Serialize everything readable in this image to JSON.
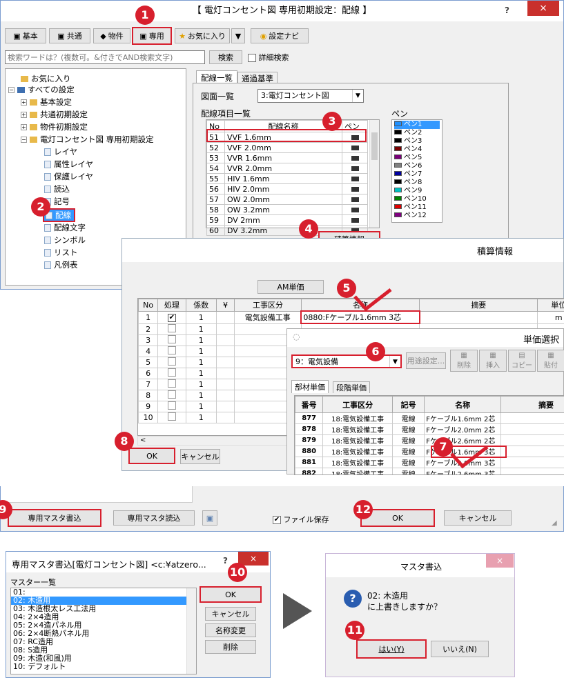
{
  "main": {
    "title": "【 電灯コンセント図 専用初期設定：配線 】",
    "help": "?",
    "close": "×",
    "toolbar": [
      "基本",
      "共通",
      "物件",
      "専用",
      "お気に入り",
      "▼",
      "設定ナビ"
    ],
    "search_placeholder": "検索ワードは？(複数可。&付きでAND検索文字)",
    "search_btn": "検索",
    "detail_label": "詳細検索",
    "tree": [
      "お気に入り",
      "すべての設定",
      "基本設定",
      "共通初期設定",
      "物件初期設定",
      "電灯コンセント図 専用初期設定",
      "レイヤ",
      "属性レイヤ",
      "保護レイヤ",
      "読込",
      "記号",
      "配線",
      "配線文字",
      "シンボル",
      "リスト",
      "凡例表"
    ],
    "tabs": [
      "配線一覧",
      "通過基準"
    ],
    "drawing_label": "図面一覧",
    "drawing_value": "3:電灯コンセント図",
    "items_label": "配線項目一覧",
    "col_no": "No",
    "col_name": "配線名称",
    "col_pen": "ペン",
    "rows": [
      [
        "51",
        "VVF 1.6mm"
      ],
      [
        "52",
        "VVF 2.0mm"
      ],
      [
        "53",
        "VVR 1.6mm"
      ],
      [
        "54",
        "VVR 2.0mm"
      ],
      [
        "55",
        "HIV 1.6mm"
      ],
      [
        "56",
        "HIV 2.0mm"
      ],
      [
        "57",
        "OW 2.0mm"
      ],
      [
        "58",
        "OW 3.2mm"
      ],
      [
        "59",
        "DV 2mm"
      ],
      [
        "60",
        "DV 3.2mm"
      ]
    ],
    "pen_label": "ペン",
    "pens": [
      [
        "ペン1",
        "#1e90ff"
      ],
      [
        "ペン2",
        "#000000"
      ],
      [
        "ペン3",
        "#000000"
      ],
      [
        "ペン4",
        "#7a0000"
      ],
      [
        "ペン5",
        "#7a007a"
      ],
      [
        "ペン6",
        "#808080"
      ],
      [
        "ペン7",
        "#0000a0"
      ],
      [
        "ペン8",
        "#000000"
      ],
      [
        "ペン9",
        "#00c0c0"
      ],
      [
        "ペン10",
        "#008000"
      ],
      [
        "ペン11",
        "#e00000"
      ],
      [
        "ペン12",
        "#800080"
      ]
    ],
    "estimate_btn": "積算情報",
    "master_write_btn": "専用マスタ書込",
    "master_read_btn": "専用マスタ読込",
    "file_save_label": "ファイル保存",
    "ok": "OK",
    "cancel": "キャンセル"
  },
  "estimate": {
    "title": "積算情報",
    "am_btn": "AM単価",
    "headers": [
      "No",
      "処理",
      "係数",
      "¥",
      "工事区分",
      "名称",
      "摘要",
      "単位"
    ],
    "row1": [
      "1",
      "✔",
      "1",
      "",
      "電気設備工事",
      "0880:Fケーブル1.6mm 3芯",
      "",
      "m"
    ],
    "rows": [
      "2",
      "3",
      "4",
      "5",
      "6",
      "7",
      "8",
      "9",
      "10"
    ],
    "coef": "1",
    "ok": "OK",
    "cancel": "キャンセル",
    "scroll_left": "<"
  },
  "unit_price": {
    "title": "単価選択",
    "select_value": "9：電気設備",
    "usage_btn": "用途設定...",
    "tools": [
      "削除",
      "挿入",
      "コピー",
      "貼付"
    ],
    "tabs": [
      "部材単価",
      "段階単価"
    ],
    "headers": [
      "番号",
      "工事区分",
      "記号",
      "名称",
      "摘要"
    ],
    "rows": [
      [
        "877",
        "18:電気設備工事",
        "電線",
        "Fケーブル1.6mm 2芯"
      ],
      [
        "878",
        "18:電気設備工事",
        "電線",
        "Fケーブル2.0mm 2芯"
      ],
      [
        "879",
        "18:電気設備工事",
        "電線",
        "Fケーブル2.6mm 2芯"
      ],
      [
        "880",
        "18:電気設備工事",
        "電線",
        "Fケーブル1.6mm 3芯"
      ],
      [
        "881",
        "18:電気設備工事",
        "電線",
        "Fケーブル2.0mm 3芯"
      ],
      [
        "882",
        "18:電気設備工事",
        "電線",
        "Fケーブル2.6mm 3芯"
      ]
    ]
  },
  "master_dialog": {
    "title": "専用マスタ書込[電灯コンセント図] <c:¥atzero...",
    "help": "?",
    "close": "×",
    "list_label": "マスター一覧",
    "items": [
      "01:",
      "02: 木造用",
      "03: 木造根太レス工法用",
      "04: 2×4造用",
      "05: 2×4造パネル用",
      "06: 2×4断熱パネル用",
      "07: RC造用",
      "08: S造用",
      "09: 木造(和風)用",
      "10: デフォルト"
    ],
    "ok": "OK",
    "cancel": "キャンセル",
    "rename": "名称変更",
    "delete": "削除"
  },
  "confirm": {
    "title": "マスタ書込",
    "close": "×",
    "message1": "02: 木造用",
    "message2": "に上書きしますか？",
    "yes": "はい(Y)",
    "no": "いいえ(N)"
  },
  "badges": [
    "1",
    "2",
    "3",
    "4",
    "5",
    "6",
    "7",
    "8",
    "9",
    "10",
    "11",
    "12"
  ]
}
